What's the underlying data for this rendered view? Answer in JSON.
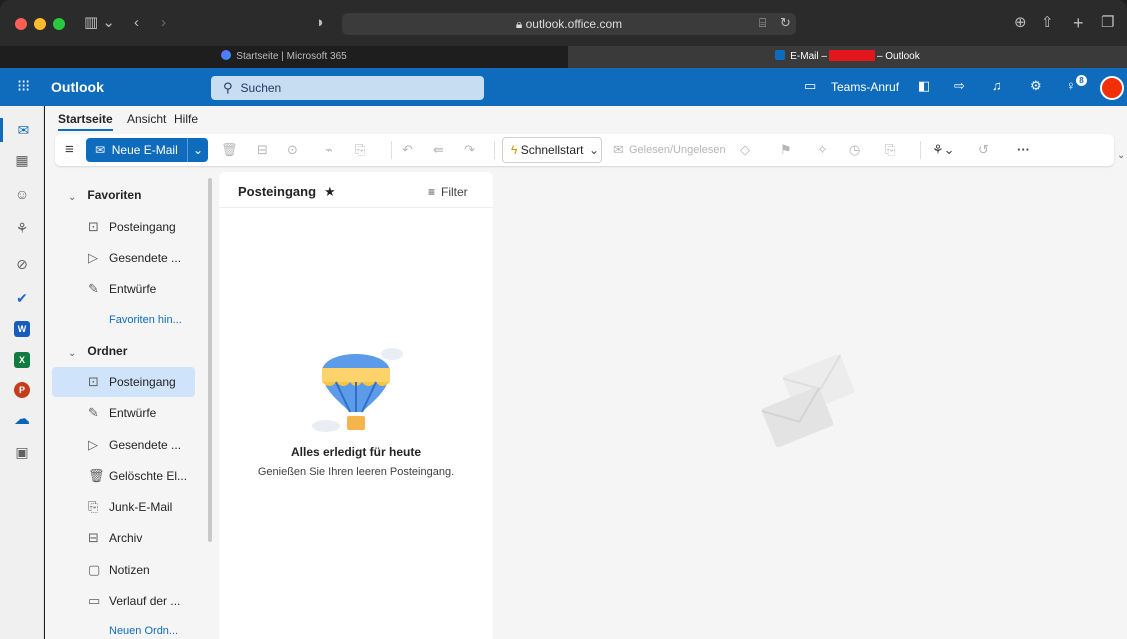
{
  "browser": {
    "url": "outlook.office.com",
    "tabs": [
      {
        "label": "Startseite | Microsoft 365",
        "active": false
      },
      {
        "label_prefix": "E-Mail –",
        "label_suffix": "– Outlook",
        "active": true
      }
    ]
  },
  "header": {
    "app_name": "Outlook",
    "search_placeholder": "Suchen",
    "teams_call": "Teams-Anruf",
    "notification_count": "8",
    "brand_color": "#0f6cbd"
  },
  "ribbon": {
    "tabs": [
      "Startseite",
      "Ansicht",
      "Hilfe"
    ],
    "new_mail": "Neue E-Mail",
    "quick_steps": "Schnellstart",
    "read_unread": "Gelesen/Ungelesen",
    "more": "···"
  },
  "folders": {
    "favorites_header": "Favoriten",
    "favorites": [
      {
        "label": "Posteingang",
        "icon": "inbox-icon"
      },
      {
        "label": "Gesendete ...",
        "icon": "send-icon"
      },
      {
        "label": "Entwürfe",
        "icon": "draft-icon"
      }
    ],
    "add_favorite": "Favoriten hin...",
    "folders_header": "Ordner",
    "folder_list": [
      {
        "label": "Posteingang",
        "icon": "inbox-icon",
        "selected": true
      },
      {
        "label": "Entwürfe",
        "icon": "draft-icon"
      },
      {
        "label": "Gesendete ...",
        "icon": "send-icon"
      },
      {
        "label": "Gelöschte El...",
        "icon": "trash-icon"
      },
      {
        "label": "Junk-E-Mail",
        "icon": "junk-icon"
      },
      {
        "label": "Archiv",
        "icon": "archive-icon"
      },
      {
        "label": "Notizen",
        "icon": "notes-icon"
      },
      {
        "label": "Verlauf der ...",
        "icon": "history-folder-icon"
      }
    ],
    "new_folder": "Neuen Ordn..."
  },
  "message_list": {
    "title": "Posteingang",
    "filter": "Filter",
    "empty_title": "Alles erledigt für heute",
    "empty_subtitle": "Genießen Sie Ihren leeren Posteingang."
  }
}
